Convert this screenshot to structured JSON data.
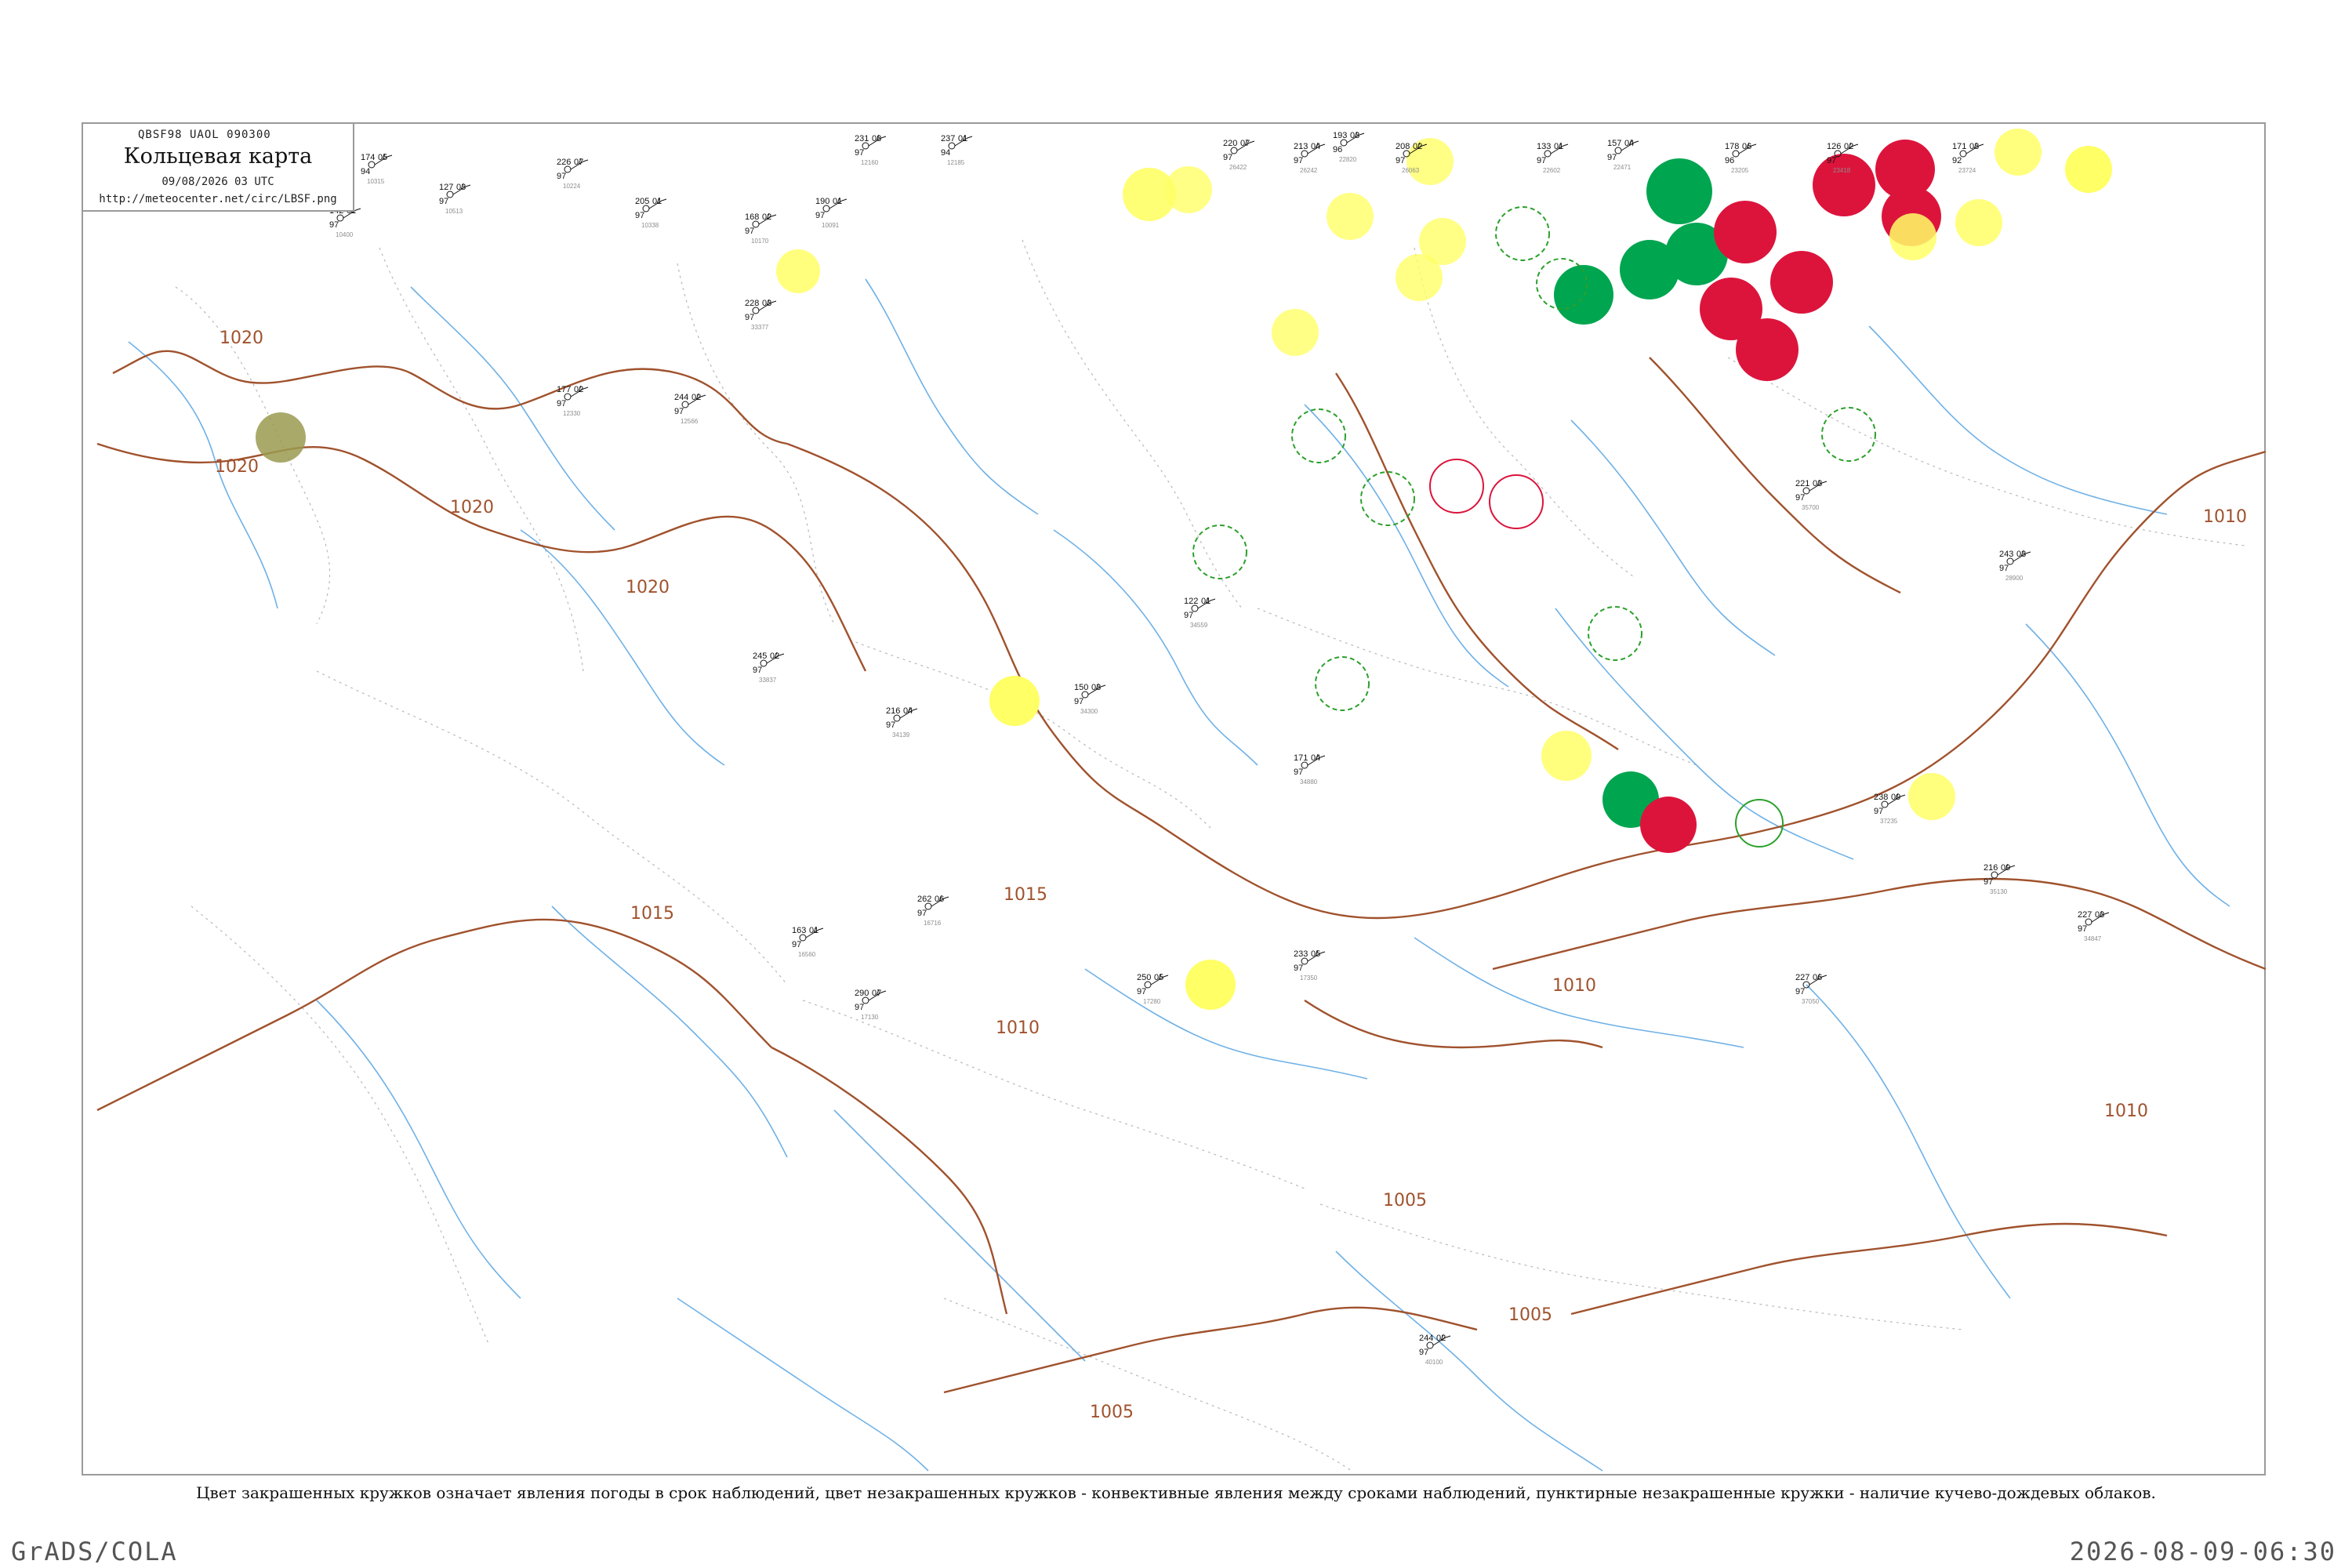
{
  "header": {
    "code": "QBSF98  UAOL  090300",
    "title": "Кольцевая карта",
    "time": "09/08/2026 03 UTC",
    "url": "http://meteocenter.net/circ/LBSF.png"
  },
  "caption": "Цвет закрашенных кружков означает явления погоды в срок наблюдений, цвет незакрашенных кружков - конвективные явления между сроками наблюдений, пунктирные незакрашенные кружки - наличие кучево-дождевых облаков.",
  "footer": {
    "left": "GrADS/COLA",
    "right": "2026-08-09-06:30"
  },
  "isobar_labels": [
    "1020",
    "1020",
    "1020",
    "1020",
    "1015",
    "1015",
    "1010",
    "1010",
    "1010",
    "1010",
    "1005",
    "1005",
    "1005"
  ],
  "colors": {
    "isobar": "#a0522d",
    "river": "#6fb1e6",
    "thunder": "#dc143c",
    "rain": "#00a550",
    "showers": "#ffff66",
    "fog": "#9a9a50",
    "cb_circle": "#2ca02c"
  },
  "stations": [
    {
      "t": "174",
      "p": "05",
      "d": "94",
      "name": "10315"
    },
    {
      "t": "142",
      "p": "01",
      "d": "97",
      "name": "10400"
    },
    {
      "t": "127",
      "p": "03",
      "d": "97",
      "name": "10513"
    },
    {
      "t": "226",
      "p": "07",
      "d": "97",
      "name": "10224"
    },
    {
      "t": "205",
      "p": "01",
      "d": "97",
      "name": "10338"
    },
    {
      "t": "168",
      "p": "02",
      "d": "97",
      "name": "10170"
    },
    {
      "t": "190",
      "p": "01",
      "d": "97",
      "name": "10091"
    },
    {
      "t": "231",
      "p": "08",
      "d": "97",
      "name": "12160"
    },
    {
      "t": "237",
      "p": "01",
      "d": "94",
      "name": "12185"
    },
    {
      "t": "220",
      "p": "07",
      "d": "97",
      "name": "26422"
    },
    {
      "t": "213",
      "p": "04",
      "d": "97",
      "name": "26242"
    },
    {
      "t": "208",
      "p": "02",
      "d": "97",
      "name": "26063"
    },
    {
      "t": "193",
      "p": "03",
      "d": "96",
      "name": "22820"
    },
    {
      "t": "133",
      "p": "01",
      "d": "97",
      "name": "22602"
    },
    {
      "t": "157",
      "p": "04",
      "d": "97",
      "name": "22471"
    },
    {
      "t": "178",
      "p": "06",
      "d": "96",
      "name": "23205"
    },
    {
      "t": "126",
      "p": "02",
      "d": "97",
      "name": "23418"
    },
    {
      "t": "171",
      "p": "03",
      "d": "92",
      "name": "23724"
    },
    {
      "t": "177",
      "p": "02",
      "d": "97",
      "name": "12330"
    },
    {
      "t": "244",
      "p": "02",
      "d": "97",
      "name": "12566"
    },
    {
      "t": "228",
      "p": "03",
      "d": "97",
      "name": "33377"
    },
    {
      "t": "245",
      "p": "02",
      "d": "97",
      "name": "33837"
    },
    {
      "t": "216",
      "p": "04",
      "d": "97",
      "name": "34139"
    },
    {
      "t": "150",
      "p": "03",
      "d": "97",
      "name": "34300"
    },
    {
      "t": "122",
      "p": "01",
      "d": "97",
      "name": "34559"
    },
    {
      "t": "171",
      "p": "04",
      "d": "97",
      "name": "34880"
    },
    {
      "t": "163",
      "p": "01",
      "d": "97",
      "name": "16560"
    },
    {
      "t": "262",
      "p": "06",
      "d": "97",
      "name": "16716"
    },
    {
      "t": "290",
      "p": "07",
      "d": "97",
      "name": "17130"
    },
    {
      "t": "250",
      "p": "05",
      "d": "97",
      "name": "17280"
    },
    {
      "t": "233",
      "p": "05",
      "d": "97",
      "name": "17350"
    },
    {
      "t": "244",
      "p": "02",
      "d": "97",
      "name": "40100"
    },
    {
      "t": "227",
      "p": "06",
      "d": "97",
      "name": "37050"
    },
    {
      "t": "238",
      "p": "09",
      "d": "97",
      "name": "37235"
    },
    {
      "t": "216",
      "p": "09",
      "d": "97",
      "name": "35130"
    },
    {
      "t": "227",
      "p": "03",
      "d": "97",
      "name": "34847"
    },
    {
      "t": "243",
      "p": "03",
      "d": "97",
      "name": "28900"
    },
    {
      "t": "221",
      "p": "03",
      "d": "97",
      "name": "35700"
    }
  ]
}
